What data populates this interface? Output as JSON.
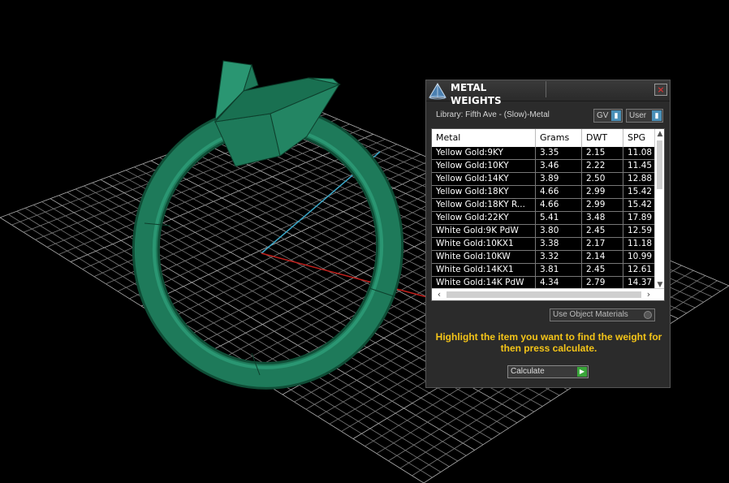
{
  "viewport": {
    "ring_color": "#1e7a5a",
    "axis_x_color": "#c0201c",
    "axis_z_color": "#3aa7c8",
    "grid_color": "#8a8a8a"
  },
  "panel": {
    "title": "METAL WEIGHTS",
    "close_label": "×",
    "library_label": "Library: Fifth Ave - (Slow)-Metal",
    "gv_select": "GV",
    "user_select": "User",
    "use_object_materials": "Use Object Materials",
    "hint": "Highlight the item you want to find the weight for then press calculate.",
    "calculate_label": "Calculate",
    "table": {
      "columns": [
        "Metal",
        "Grams",
        "DWT",
        "SPG"
      ],
      "rows": [
        [
          "Yellow Gold:9KY",
          "3.35",
          "2.15",
          "11.08"
        ],
        [
          "Yellow Gold:10KY",
          "3.46",
          "2.22",
          "11.45"
        ],
        [
          "Yellow Gold:14KY",
          "3.89",
          "2.50",
          "12.88"
        ],
        [
          "Yellow Gold:18KY",
          "4.66",
          "2.99",
          "15.42"
        ],
        [
          "Yellow Gold:18KY R...",
          "4.66",
          "2.99",
          "15.42"
        ],
        [
          "Yellow Gold:22KY",
          "5.41",
          "3.48",
          "17.89"
        ],
        [
          "White Gold:9K PdW",
          "3.80",
          "2.45",
          "12.59"
        ],
        [
          "White Gold:10KX1",
          "3.38",
          "2.17",
          "11.18"
        ],
        [
          "White Gold:10KW",
          "3.32",
          "2.14",
          "10.99"
        ],
        [
          "White Gold:14KX1",
          "3.81",
          "2.45",
          "12.61"
        ],
        [
          "White Gold:14K PdW",
          "4.34",
          "2.79",
          "14.37"
        ]
      ]
    }
  }
}
